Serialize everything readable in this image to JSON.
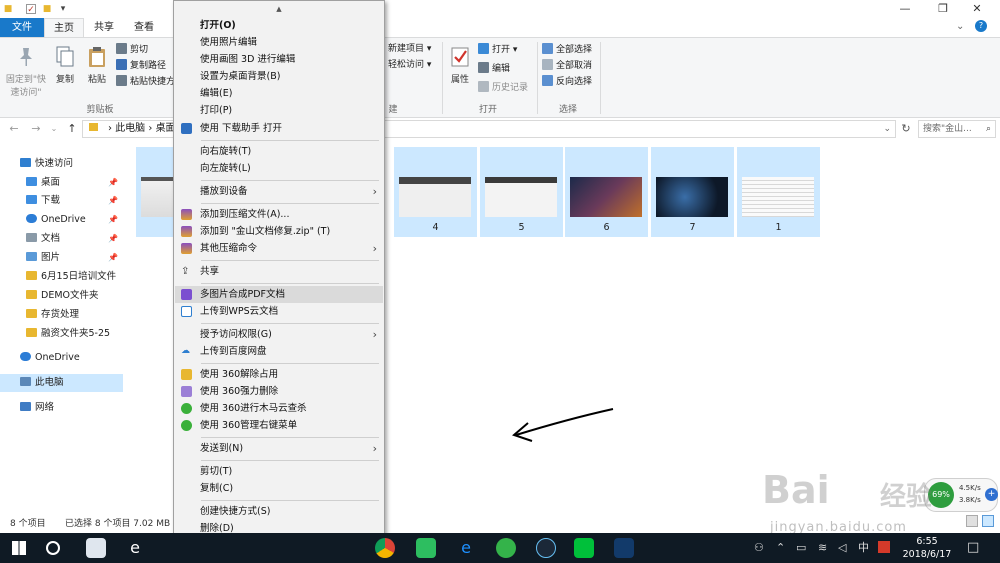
{
  "titlebar": {
    "down_arrow": "▾"
  },
  "window_controls": {
    "minimize": "—",
    "maximize": "❐",
    "close": "✕",
    "help": "?"
  },
  "tabs": [
    "文件",
    "主页",
    "共享",
    "查看"
  ],
  "ribbon": {
    "pin_label_1": "固定到\"快",
    "pin_label_2": "速访问\"",
    "copy": "复制",
    "paste": "粘贴",
    "cut": "剪切",
    "copy_path": "复制路径",
    "paste_shortcut": "粘贴快捷方",
    "group_clipboard": "剪贴板",
    "new_item": "新建项目",
    "easy_access": "轻松访问",
    "group_new": "建",
    "properties": "属性",
    "open": "打开",
    "edit": "编辑",
    "history": "历史记录",
    "group_open": "打开",
    "select_all": "全部选择",
    "select_none": "全部取消",
    "invert": "反向选择",
    "group_select": "选择"
  },
  "address": {
    "path_root": "此电脑",
    "path_sep": "›",
    "path_current": "桌面",
    "search_placeholder": "搜索\"金山..."
  },
  "nav": {
    "quick_access": "快速访问",
    "items": [
      "桌面",
      "下载",
      "OneDrive",
      "文档",
      "图片",
      "6月15日培训文件",
      "DEMO文件夹",
      "存货处理",
      "融资文件夹5-25"
    ],
    "onedrive": "OneDrive",
    "this_pc": "此电脑",
    "network": "网络"
  },
  "thumbnails": [
    "4",
    "5",
    "6",
    "7",
    "1"
  ],
  "status": {
    "count": "8 个项目",
    "selected": "已选择 8 个项目  7.02 MB"
  },
  "menu": {
    "scroll_up": "▲",
    "scroll_down": "▼",
    "items": [
      "打开(O)",
      "使用照片编辑",
      "使用画图 3D 进行编辑",
      "设置为桌面背景(B)",
      "编辑(E)",
      "打印(P)",
      "使用 下载助手 打开",
      "向右旋转(T)",
      "向左旋转(L)",
      "播放到设备",
      "添加到压缩文件(A)...",
      "添加到 \"金山文档修复.zip\" (T)",
      "其他压缩命令",
      "共享",
      "多图片合成PDF文档",
      "上传到WPS云文档",
      "授予访问权限(G)",
      "上传到百度网盘",
      "使用 360解除占用",
      "使用 360强力删除",
      "使用 360进行木马云查杀",
      "使用 360管理右键菜单",
      "发送到(N)",
      "剪切(T)",
      "复制(C)",
      "创建快捷方式(S)",
      "删除(D)"
    ]
  },
  "speed_widget": {
    "percent": "69%",
    "up": "4.5K/s",
    "down": "3.8K/s"
  },
  "clock": {
    "time": "6:55",
    "date": "2018/6/17"
  },
  "tray": {
    "lang": "中",
    "notify": "□"
  },
  "watermark": {
    "brand": "Bai",
    "brand2": "经验",
    "url": "jingyan.baidu.com"
  },
  "colors": {
    "accent": "#1979ca",
    "selection": "#cce8ff",
    "menu_bg": "#f2f2f2",
    "taskbar": "#0f1a24"
  }
}
